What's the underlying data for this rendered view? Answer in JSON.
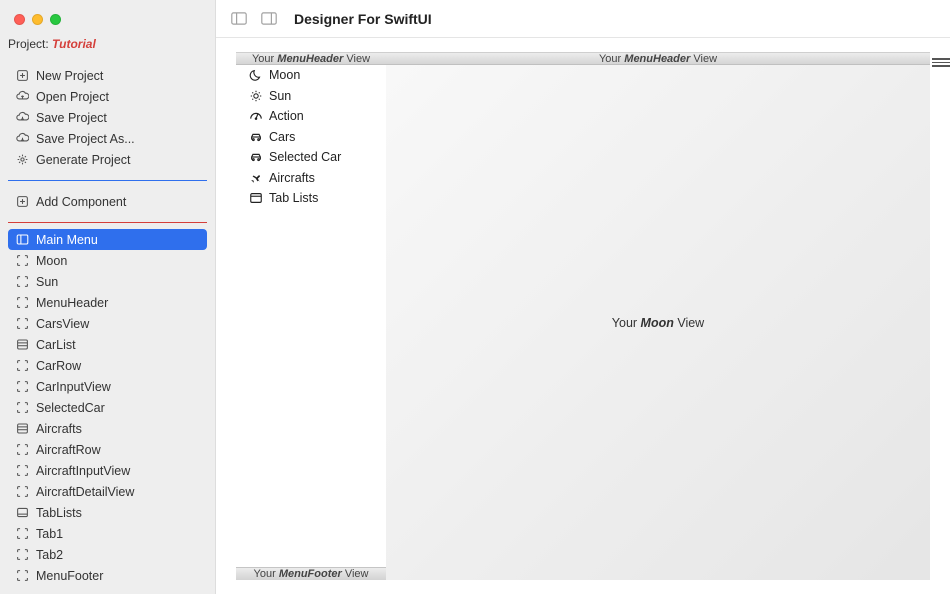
{
  "window": {
    "title": "Designer For SwiftUI",
    "project_label": "Project:",
    "project_name": "Tutorial"
  },
  "sidebar": {
    "project_actions": [
      {
        "label": "New Project",
        "icon": "plus-square"
      },
      {
        "label": "Open Project",
        "icon": "cloud-up"
      },
      {
        "label": "Save Project",
        "icon": "cloud-down"
      },
      {
        "label": "Save Project As...",
        "icon": "cloud-down"
      },
      {
        "label": "Generate Project",
        "icon": "gear"
      }
    ],
    "add_component": {
      "label": "Add Component",
      "icon": "plus-square"
    },
    "components": [
      {
        "label": "Main Menu",
        "icon": "sidebar-layout",
        "selected": true
      },
      {
        "label": "Moon",
        "icon": "viewfinder"
      },
      {
        "label": "Sun",
        "icon": "viewfinder"
      },
      {
        "label": "MenuHeader",
        "icon": "viewfinder"
      },
      {
        "label": "CarsView",
        "icon": "viewfinder"
      },
      {
        "label": "CarList",
        "icon": "list-box"
      },
      {
        "label": "CarRow",
        "icon": "viewfinder"
      },
      {
        "label": "CarInputView",
        "icon": "viewfinder"
      },
      {
        "label": "SelectedCar",
        "icon": "viewfinder"
      },
      {
        "label": "Aircrafts",
        "icon": "list-box"
      },
      {
        "label": "AircraftRow",
        "icon": "viewfinder"
      },
      {
        "label": "AircraftInputView",
        "icon": "viewfinder"
      },
      {
        "label": "AircraftDetailView",
        "icon": "viewfinder"
      },
      {
        "label": "TabLists",
        "icon": "tab-box"
      },
      {
        "label": "Tab1",
        "icon": "viewfinder"
      },
      {
        "label": "Tab2",
        "icon": "viewfinder"
      },
      {
        "label": "MenuFooter",
        "icon": "viewfinder"
      }
    ]
  },
  "preview": {
    "menu_header_prefix": "Your ",
    "menu_header_name": "MenuHeader",
    "menu_header_suffix": " View",
    "menu_footer_prefix": "Your ",
    "menu_footer_name": "MenuFooter",
    "menu_footer_suffix": " View",
    "detail_prefix": "Your ",
    "detail_name": "Moon",
    "detail_suffix": " View",
    "detail_header_prefix": "Your ",
    "detail_header_name": "MenuHeader",
    "detail_header_suffix": " View",
    "menu_items": [
      {
        "label": "Moon",
        "icon": "moon"
      },
      {
        "label": "Sun",
        "icon": "sun"
      },
      {
        "label": "Action",
        "icon": "speed"
      },
      {
        "label": "Cars",
        "icon": "car"
      },
      {
        "label": "Selected Car",
        "icon": "car"
      },
      {
        "label": "Aircrafts",
        "icon": "plane"
      },
      {
        "label": "Tab Lists",
        "icon": "window"
      }
    ]
  }
}
